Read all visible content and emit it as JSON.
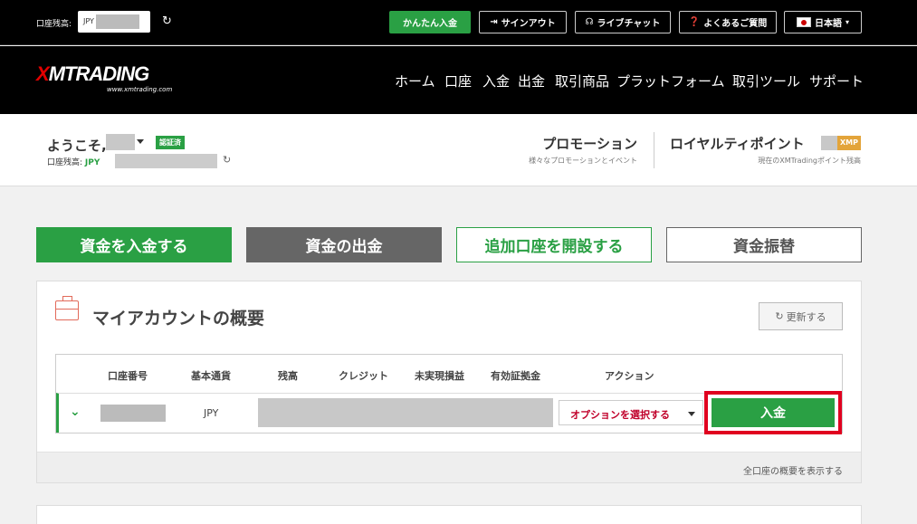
{
  "topbar": {
    "balance_label": "口座残高:",
    "balance_prefix": "JPY",
    "easy_deposit": "かんたん入金",
    "signout": "サインアウト",
    "live_chat": "ライブチャット",
    "faq": "よくあるご質問",
    "language": "日本語"
  },
  "nav": {
    "logo": "XMTRADING",
    "logo_x": "X",
    "logo_rest": "MTRADING",
    "logo_url_text": "www.xmtrading.com",
    "items": [
      "ホーム",
      "口座",
      "入金",
      "出金",
      "取引商品",
      "プラットフォーム",
      "取引ツール",
      "サポート"
    ]
  },
  "welcome": {
    "greeting": "ようこそ,",
    "verified_badge": "認証済",
    "balance_label": "口座残高:",
    "balance_currency": "JPY",
    "promo_title": "プロモーション",
    "promo_sub": "様々なプロモーションとイベント",
    "loyalty_title": "ロイヤルティポイント",
    "loyalty_unit": "XMP",
    "loyalty_sub": "現在のXMTradingポイント残高"
  },
  "actions": {
    "deposit": "資金を入金する",
    "withdraw": "資金の出金",
    "open_account": "追加口座を開設する",
    "transfer": "資金振替"
  },
  "overview": {
    "title": "マイアカウントの概要",
    "update_button": "更新する",
    "columns": [
      "口座番号",
      "基本通貨",
      "残高",
      "クレジット",
      "未実現損益",
      "有効証拠金",
      "アクション"
    ],
    "row": {
      "currency": "JPY",
      "select_placeholder": "オプションを選択する",
      "deposit_button": "入金"
    },
    "view_all": "全口座の概要を表示する"
  },
  "colors": {
    "brand_green": "#2aa044",
    "highlight_red": "#e0001f",
    "loyalty_orange": "#e3a43a"
  }
}
